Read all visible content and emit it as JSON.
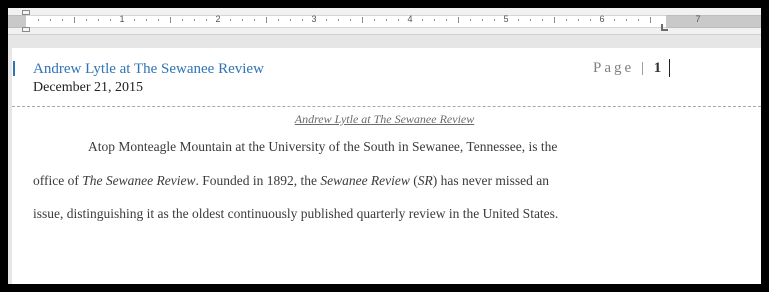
{
  "ruler": {
    "numbers": [
      "1",
      "2",
      "3",
      "4",
      "5",
      "6",
      "7"
    ]
  },
  "header": {
    "title": "Andrew Lytle at The Sewanee Review",
    "date": "December 21, 2015",
    "page_label": "Page",
    "page_separator": "|",
    "page_number": "1"
  },
  "document": {
    "title": "Andrew Lytle at The Sewanee Review",
    "line1": "Atop Monteagle Mountain at the University of the South in Sewanee, Tennessee, is the",
    "line2_a": "office of ",
    "line2_italic_a": "The Sewanee Review",
    "line2_b": ". Founded in 1892, the ",
    "line2_italic_b": "Sewanee Review",
    "line2_c": " (",
    "line2_italic_c": "SR",
    "line2_d": ") has never missed an",
    "line3": "issue, distinguishing it as the oldest continuously published quarterly review in the United States."
  },
  "colors": {
    "header_title": "#2e74b5",
    "page_label": "#7f7f7f",
    "body_text": "#3a3a3a"
  }
}
